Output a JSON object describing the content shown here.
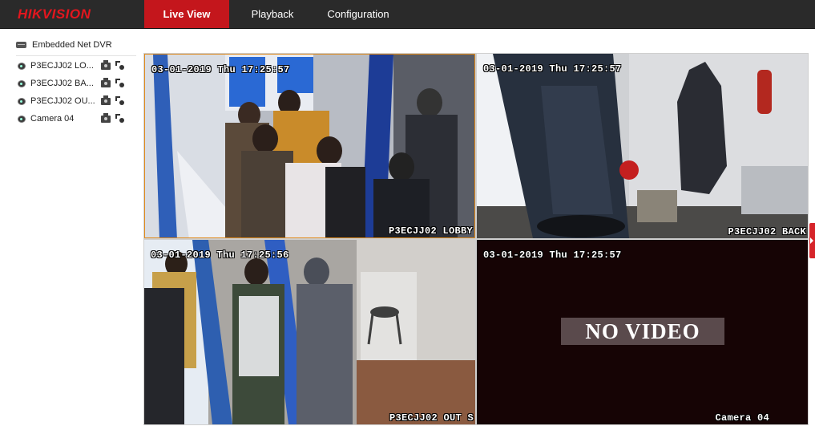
{
  "brand": {
    "logo_text": "HIKVISION",
    "logo_color": "#e3161e"
  },
  "nav": {
    "live_view": "Live View",
    "playback": "Playback",
    "configuration": "Configuration",
    "active": "Live View",
    "active_color": "#c4161c"
  },
  "sidebar": {
    "device_name": "Embedded Net DVR",
    "cameras": [
      {
        "label": "P3ECJJ02 LO...",
        "icon": "camera-icon"
      },
      {
        "label": "P3ECJJ02 BA...",
        "icon": "camera-icon"
      },
      {
        "label": "P3ECJJ02 OU...",
        "icon": "camera-icon"
      },
      {
        "label": "Camera 04",
        "icon": "camera-icon"
      }
    ]
  },
  "tiles": [
    {
      "timestamp": "03-01-2019 Thu 17:25:57",
      "name": "P3ECJJ02 LOBBY",
      "selected": true
    },
    {
      "timestamp": "03-01-2019 Thu 17:25:57",
      "name": "P3ECJJ02 BACK",
      "selected": false
    },
    {
      "timestamp": "03-01-2019 Thu 17:25:56",
      "name": "P3ECJJ02 OUT S",
      "selected": false
    },
    {
      "timestamp": "03-01-2019 Thu 17:25:57",
      "name": "Camera 04",
      "no_video": "NO VIDEO",
      "selected": false
    }
  ]
}
